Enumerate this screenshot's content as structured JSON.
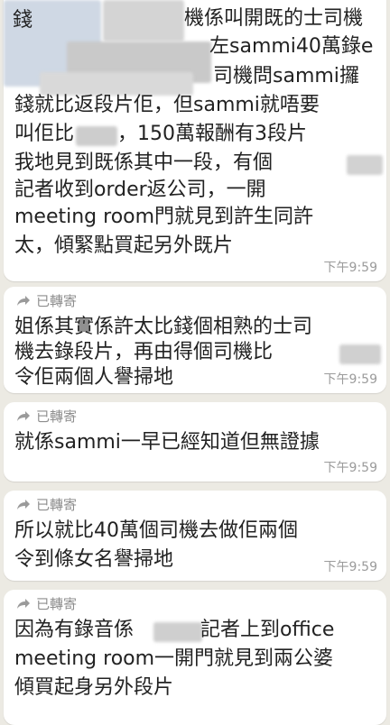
{
  "forward_label": "已轉寄",
  "time": "下午9:59",
  "messages": [
    {
      "lines": [
        "錢",
        "機係叫開既的士司機",
        "左sammi40萬錄e",
        "司機問sammi攞",
        "錢就比返段片佢，但sammi就唔要",
        "叫佢比",
        "，150萬報酬有3段片",
        "我地見到既係其中一段，有個",
        "記者收到order返公司，一開",
        "meeting room門就見到許生同許",
        "太，傾緊點買起另外既片"
      ]
    },
    {
      "lines": [
        "姐係其實係許太比錢個相熟的士司",
        "機去錄段片，再由得個司機比",
        "令佢兩個人譽掃地"
      ]
    },
    {
      "lines": [
        "就係sammi一早已經知道但無證據"
      ]
    },
    {
      "lines": [
        "所以就比40萬個司機去做佢兩個",
        "令到條女名譽掃地"
      ]
    },
    {
      "lines": [
        "因為有錄音係",
        "記者上到office",
        "meeting room一開門就見到兩公婆",
        "傾買起身另外段片"
      ]
    }
  ]
}
